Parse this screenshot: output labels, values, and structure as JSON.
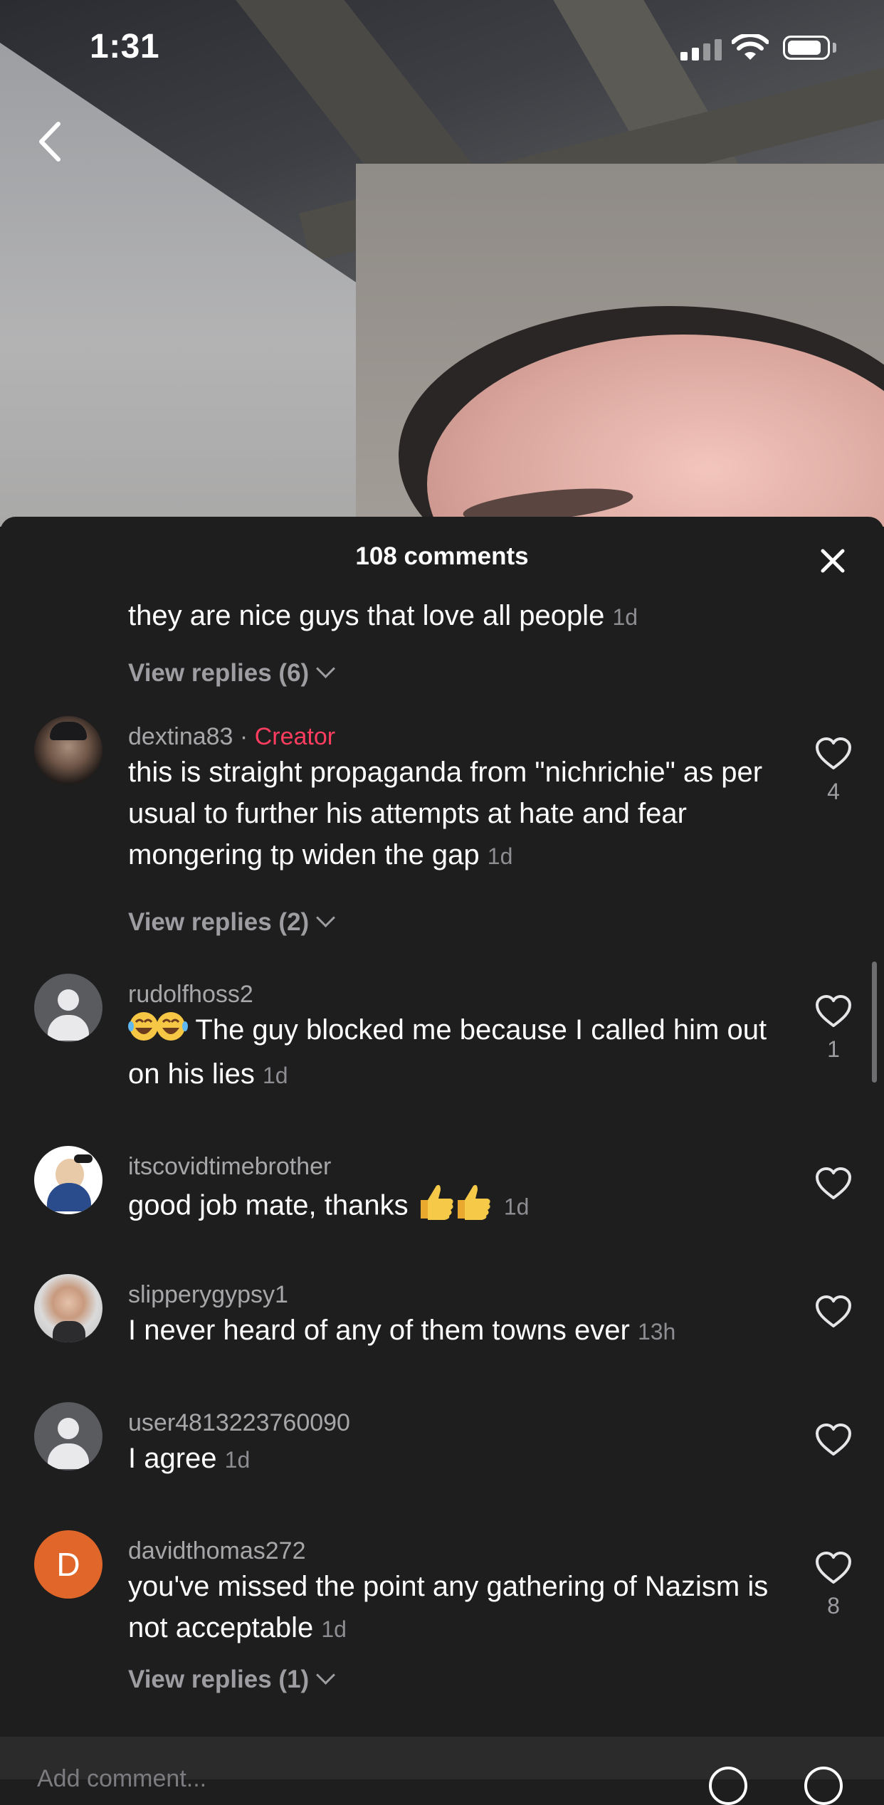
{
  "status": {
    "time": "1:31"
  },
  "sheet": {
    "title": "108 comments"
  },
  "partial_comment": {
    "text": "they are nice guys that love all people",
    "time": "1d",
    "view_replies": "View replies (6)"
  },
  "comments": [
    {
      "username": "dextina83",
      "separator": " · ",
      "badge": "Creator",
      "text": "this is straight propaganda from \"nichrichie\" as per usual to further his attempts at hate and fear mongering tp widen the gap",
      "time": "1d",
      "likes": "4",
      "view_replies": "View replies (2)",
      "avatar": "photo"
    },
    {
      "username": "rudolfhoss2",
      "text": " The guy blocked me because I called him out on his lies",
      "time": "1d",
      "likes": "1",
      "avatar": "default"
    },
    {
      "username": "itscovidtimebrother",
      "text": "good job mate, thanks ",
      "time": "1d",
      "likes": "",
      "avatar": "cartoon"
    },
    {
      "username": "slipperygypsy1",
      "text": "I never heard of any of them towns ever",
      "time": "13h",
      "likes": "",
      "avatar": "photo"
    },
    {
      "username": "user4813223760090",
      "text": "I agree",
      "time": "1d",
      "likes": "",
      "avatar": "default"
    },
    {
      "username": "davidthomas272",
      "text": "you've missed the point any gathering of Nazism is not acceptable",
      "time": "1d",
      "likes": "8",
      "view_replies": "View replies (1)",
      "avatar_initial": "D"
    }
  ],
  "add_comment": {
    "placeholder": "Add comment..."
  },
  "colors": {
    "sheet_bg": "#1e1e1f",
    "creator": "#ff3d5e",
    "muted_text": "#a7a7aa"
  },
  "icons": [
    "back-chevron-icon",
    "close-icon",
    "heart-icon",
    "chevron-down-icon",
    "wifi-icon",
    "battery-icon",
    "signal-icon"
  ]
}
